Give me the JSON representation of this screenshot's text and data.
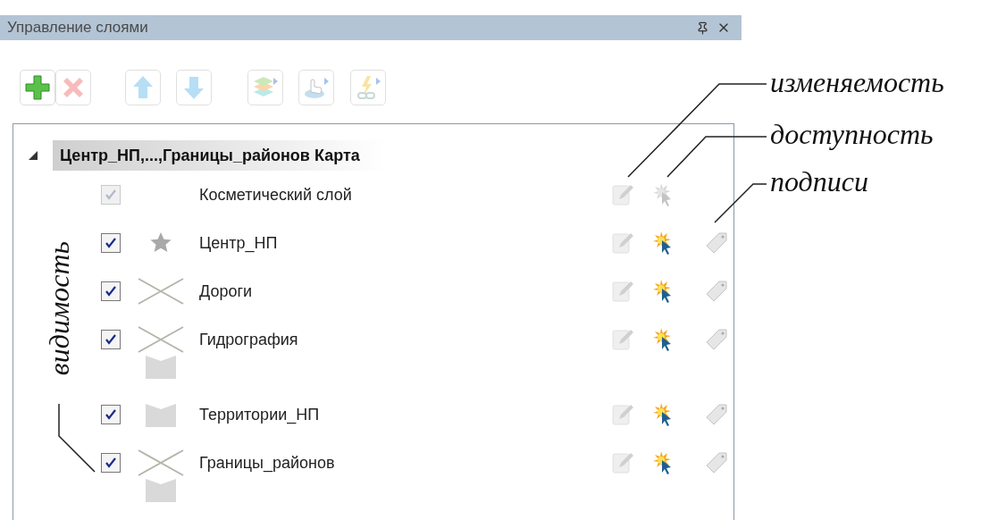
{
  "panel": {
    "title": "Управление слоями"
  },
  "toolbar": [
    {
      "kind": "add",
      "disabled": false
    },
    {
      "kind": "delete",
      "disabled": true
    },
    {
      "kind": "up",
      "disabled": true
    },
    {
      "kind": "down",
      "disabled": true
    },
    {
      "kind": "layers",
      "disabled": true
    },
    {
      "kind": "hand",
      "disabled": true
    },
    {
      "kind": "lightning",
      "disabled": true
    }
  ],
  "tree": {
    "label": "Центр_НП,...,Границы_районов Карта",
    "expanded": true,
    "selected": true,
    "children": [
      {
        "kind": "cosmetic",
        "label": "Косметический слой",
        "visible": true,
        "disabled": true,
        "editable": false,
        "selectable": false
      },
      {
        "kind": "layer",
        "label": "Центр_НП",
        "visible": true,
        "disabled": false,
        "symbols": [
          {
            "kind": "point"
          }
        ],
        "editable": false,
        "selectable": true
      },
      {
        "kind": "layer",
        "label": "Дороги",
        "visible": true,
        "disabled": false,
        "symbols": [
          {
            "kind": "line"
          }
        ],
        "editable": false,
        "selectable": true
      },
      {
        "kind": "layer",
        "label": "Гидрография",
        "visible": true,
        "disabled": false,
        "symbols": [
          {
            "kind": "line"
          },
          {
            "kind": "polygon"
          }
        ],
        "editable": false,
        "selectable": true
      },
      {
        "kind": "layer",
        "label": "Территории_НП",
        "visible": true,
        "disabled": false,
        "symbols": [
          {
            "kind": "polygon"
          }
        ],
        "editable": false,
        "selectable": true
      },
      {
        "kind": "layer",
        "label": "Границы_районов",
        "visible": true,
        "disabled": false,
        "symbols": [
          {
            "kind": "line"
          },
          {
            "kind": "polygon"
          }
        ],
        "editable": false,
        "selectable": true
      }
    ]
  },
  "annotations": [
    {
      "text": "изменяемость"
    },
    {
      "text": "доступность"
    },
    {
      "text": "подписи"
    },
    {
      "text": "видимость"
    }
  ]
}
